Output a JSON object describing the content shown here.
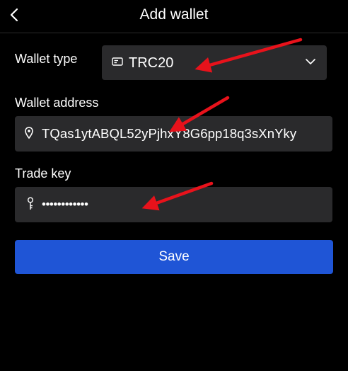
{
  "header": {
    "title": "Add wallet",
    "back_icon": "chevron-left-icon"
  },
  "form": {
    "wallet_type": {
      "label": "Wallet type",
      "value": "TRC20",
      "icon": "card-icon",
      "dropdown_icon": "chevron-down-icon"
    },
    "wallet_address": {
      "label": "Wallet address",
      "value": "TQas1ytABQL52yPjhxY8G6pp18q3sXnYky",
      "icon": "location-pin-icon"
    },
    "trade_key": {
      "label": "Trade key",
      "value": "••••••••••••",
      "icon": "key-icon"
    }
  },
  "actions": {
    "save_label": "Save"
  },
  "annotations": {
    "arrow_color": "#e8121b"
  },
  "colors": {
    "background": "#000000",
    "field_bg": "#2a2a2c",
    "primary": "#1f55d6",
    "text": "#ffffff"
  }
}
